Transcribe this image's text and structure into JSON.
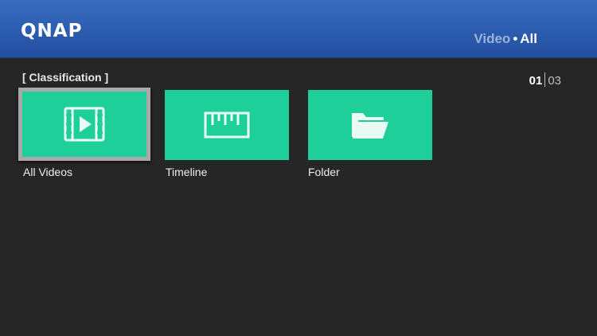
{
  "header": {
    "brand": "QNAP",
    "breadcrumb": {
      "section": "Video",
      "separator": "•",
      "current": "All"
    }
  },
  "classification": {
    "title": "[ Classification ]",
    "pager": {
      "current": "01",
      "total": "03"
    },
    "tiles": [
      {
        "label": "All Videos",
        "icon": "film-play-icon",
        "selected": true
      },
      {
        "label": "Timeline",
        "icon": "ruler-icon",
        "selected": false
      },
      {
        "label": "Folder",
        "icon": "folder-icon",
        "selected": false
      }
    ]
  },
  "colors": {
    "header_blue": "#2d5fb3",
    "tile_green": "#1fcf9a",
    "background": "#262626",
    "selection_border": "#a9a9a9"
  }
}
